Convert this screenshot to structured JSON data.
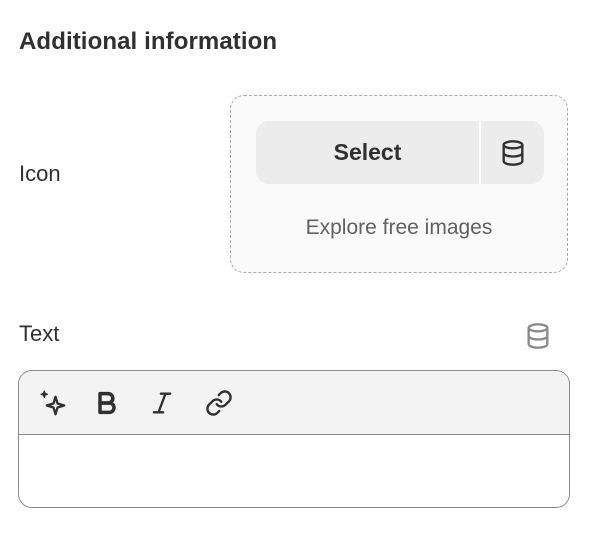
{
  "section": {
    "title": "Additional information"
  },
  "icon_field": {
    "label": "Icon",
    "select_label": "Select",
    "dynamic_source_icon": "database-icon",
    "explore_label": "Explore free images"
  },
  "text_field": {
    "label": "Text",
    "dynamic_source_icon": "database-icon",
    "toolbar": [
      {
        "name": "sparkle-icon"
      },
      {
        "name": "bold-icon"
      },
      {
        "name": "italic-icon"
      },
      {
        "name": "link-icon"
      }
    ],
    "value": ""
  },
  "colors": {
    "text": "#303030",
    "muted": "#616161",
    "button_bg": "#ececec",
    "toolbar_bg": "#f3f3f3",
    "border": "#8a8a8a"
  }
}
